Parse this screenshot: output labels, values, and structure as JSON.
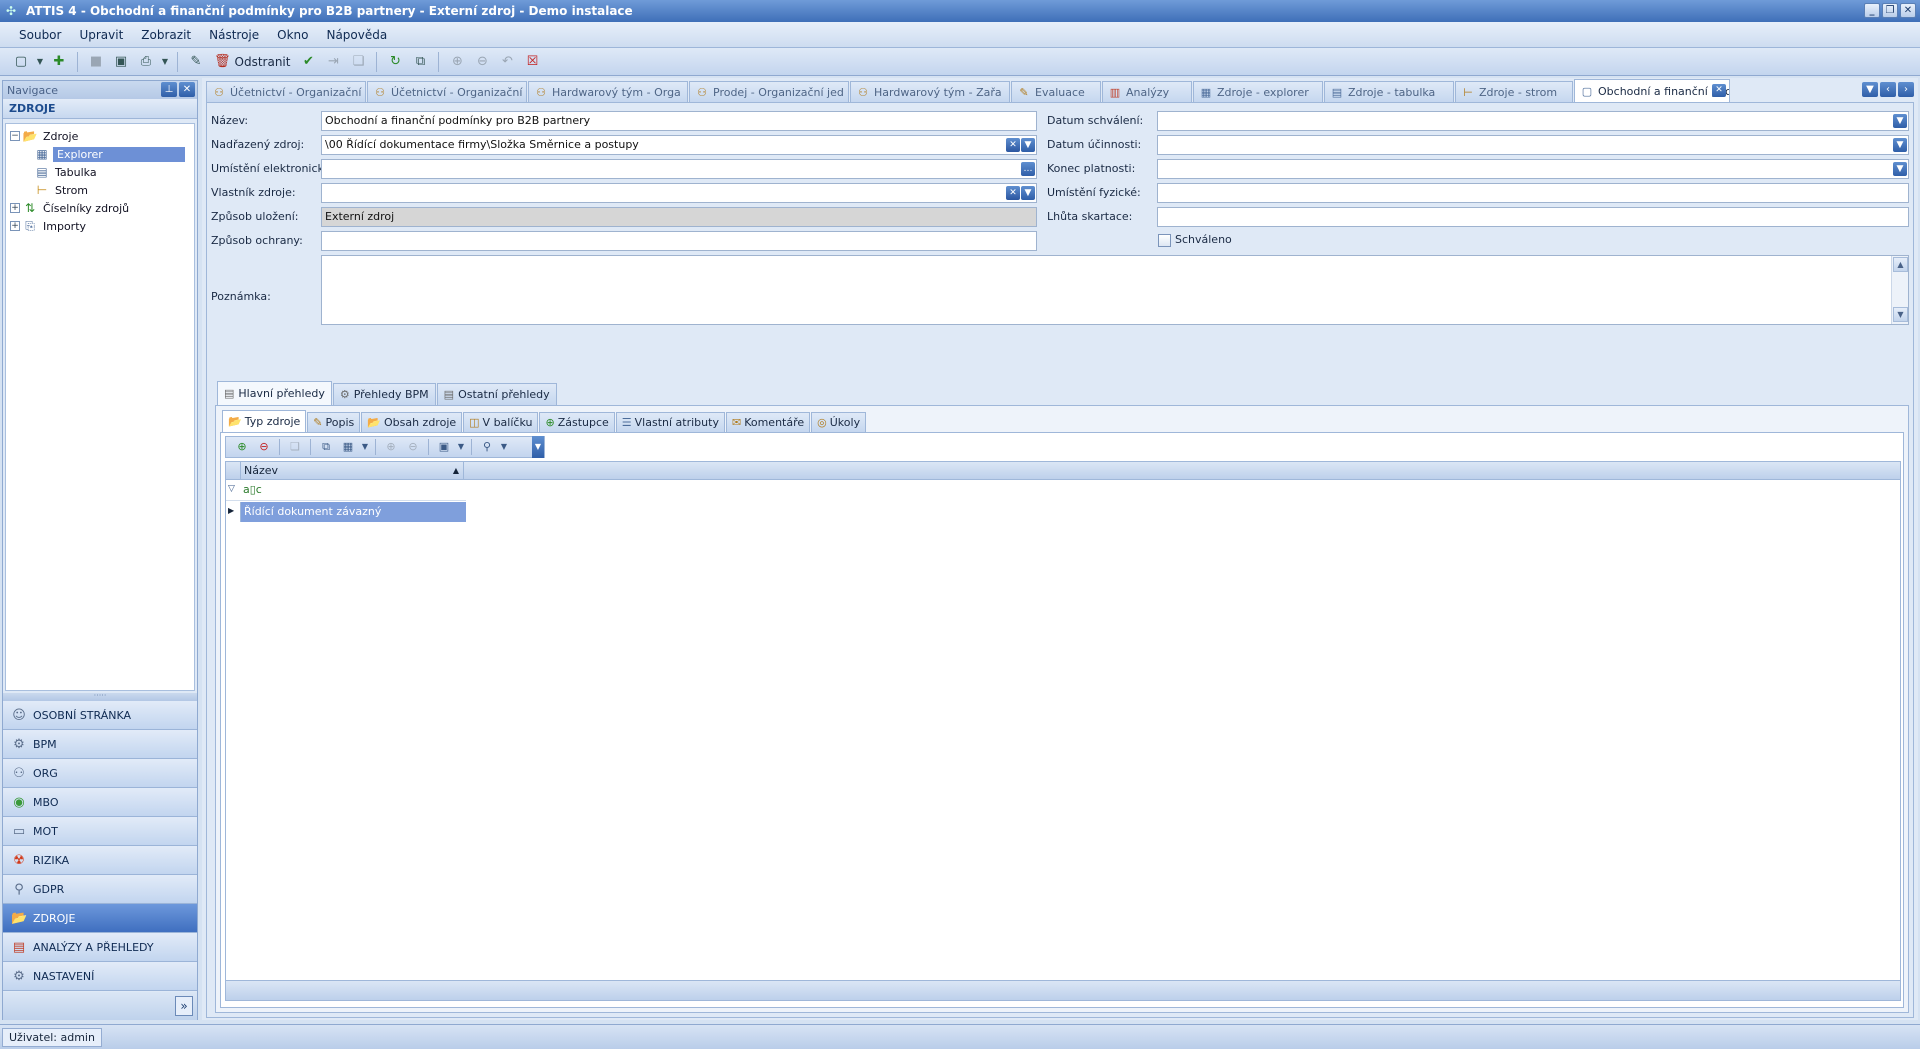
{
  "window": {
    "title": "ATTIS 4 - Obchodní a finanční podmínky pro B2B partnery - Externí zdroj - Demo instalace"
  },
  "menu": [
    "Soubor",
    "Upravit",
    "Zobrazit",
    "Nástroje",
    "Okno",
    "Nápověda"
  ],
  "toolbar": {
    "remove_label": "Odstranit"
  },
  "nav": {
    "header": "Navigace",
    "section": "ZDROJE",
    "tree": [
      {
        "label": "Zdroje",
        "level": 0,
        "expander": "−",
        "icon": "folder-icon"
      },
      {
        "label": "Explorer",
        "level": 1,
        "selected": true,
        "icon": "grid-icon"
      },
      {
        "label": "Tabulka",
        "level": 1,
        "icon": "table-icon"
      },
      {
        "label": "Strom",
        "level": 1,
        "icon": "tree-icon"
      },
      {
        "label": "Číselníky zdrojů",
        "level": 0,
        "expander": "+",
        "icon": "list-icon"
      },
      {
        "label": "Importy",
        "level": 0,
        "expander": "+",
        "icon": "import-icon"
      }
    ],
    "modules": [
      {
        "label": "OSOBNÍ STRÁNKA",
        "icon": "person-icon"
      },
      {
        "label": "BPM",
        "icon": "process-icon"
      },
      {
        "label": "ORG",
        "icon": "org-icon"
      },
      {
        "label": "MBO",
        "icon": "target-icon"
      },
      {
        "label": "MOT",
        "icon": "card-icon"
      },
      {
        "label": "RIZIKA",
        "icon": "hazard-icon"
      },
      {
        "label": "GDPR",
        "icon": "shield-person-icon"
      },
      {
        "label": "ZDROJE",
        "icon": "folder-icon",
        "active": true
      },
      {
        "label": "ANALÝZY A PŘEHLEDY",
        "icon": "report-icon"
      },
      {
        "label": "NASTAVENÍ",
        "icon": "gear-icon"
      }
    ]
  },
  "doc_tabs": [
    {
      "label": "Účetnictví - Organizační",
      "icon": "org-icon"
    },
    {
      "label": "Účetnictví - Organizační",
      "icon": "org-icon"
    },
    {
      "label": "Hardwarový tým - Orga",
      "icon": "org-icon"
    },
    {
      "label": "Prodej - Organizační jed",
      "icon": "org-icon"
    },
    {
      "label": "Hardwarový tým - Zařa",
      "icon": "org-icon"
    },
    {
      "label": "Evaluace",
      "icon": "evaluation-icon"
    },
    {
      "label": "Analýzy",
      "icon": "chart-icon"
    },
    {
      "label": "Zdroje - explorer",
      "icon": "grid-icon"
    },
    {
      "label": "Zdroje - tabulka",
      "icon": "table-icon"
    },
    {
      "label": "Zdroje - strom",
      "icon": "tree-icon"
    },
    {
      "label": "Obchodní a finanční poc",
      "icon": "document-icon",
      "active": true
    }
  ],
  "form": {
    "nazev": {
      "label": "Název:",
      "value": "Obchodní a finanční podmínky pro B2B partnery"
    },
    "nadrazeny": {
      "label": "Nadřazený zdroj:",
      "value": "\\00 Řídící dokumentace firmy\\Složka Směrnice a postupy"
    },
    "umisteni_el": {
      "label": "Umístění elektronické:",
      "value": ""
    },
    "vlastnik": {
      "label": "Vlastník zdroje:",
      "value": ""
    },
    "zpusob_ulozeni": {
      "label": "Způsob uložení:",
      "value": "Externí zdroj"
    },
    "zpusob_ochrany": {
      "label": "Způsob ochrany:",
      "value": ""
    },
    "poznamka": {
      "label": "Poznámka:",
      "value": ""
    },
    "datum_schvaleni": {
      "label": "Datum schválení:",
      "value": ""
    },
    "datum_ucinnosti": {
      "label": "Datum účinnosti:",
      "value": ""
    },
    "konec_platnosti": {
      "label": "Konec platnosti:",
      "value": ""
    },
    "umisteni_fyz": {
      "label": "Umístění fyzické:",
      "value": ""
    },
    "lhuta_skartace": {
      "label": "Lhůta skartace:",
      "value": ""
    },
    "schvaleno": {
      "label": "Schváleno",
      "checked": false
    }
  },
  "main_tabs": [
    {
      "label": "Hlavní přehledy",
      "active": true
    },
    {
      "label": "Přehledy BPM"
    },
    {
      "label": "Ostatní přehledy"
    }
  ],
  "sub_tabs": [
    {
      "label": "Typ zdroje",
      "active": true
    },
    {
      "label": "Popis"
    },
    {
      "label": "Obsah zdroje"
    },
    {
      "label": "V balíčku"
    },
    {
      "label": "Zástupce"
    },
    {
      "label": "Vlastní atributy"
    },
    {
      "label": "Komentáře"
    },
    {
      "label": "Úkoly"
    }
  ],
  "grid": {
    "column": "Název",
    "filter_value": "a▯c",
    "rows": [
      {
        "name": "Řídící dokument závazný",
        "selected": true
      }
    ]
  },
  "status": {
    "user": "Uživatel: admin"
  },
  "colors": {
    "accent": "#3f6fc0",
    "selection": "#6d90d6"
  }
}
